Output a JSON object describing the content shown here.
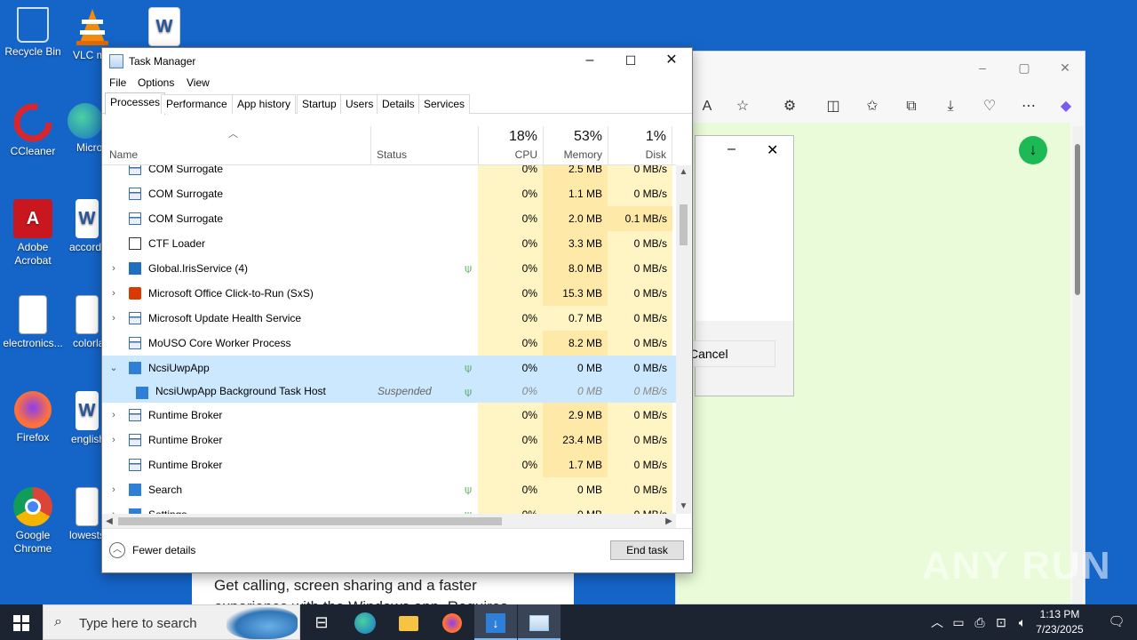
{
  "desktop": {
    "icons": [
      {
        "label": "Recycle Bin",
        "icon": "recycle-bin-icon"
      },
      {
        "label": "VLC media player",
        "icon": "vlc-icon"
      },
      {
        "label": "",
        "icon": "word-doc-icon"
      },
      {
        "label": "CCleaner",
        "icon": "ccleaner-icon"
      },
      {
        "label": "Microsoft Edge",
        "icon": "edge-icon"
      },
      {
        "label": "Adobe Acrobat",
        "icon": "acrobat-icon"
      },
      {
        "label": "accord...",
        "icon": "word-doc-icon"
      },
      {
        "label": "electronics...",
        "icon": "image-file-icon"
      },
      {
        "label": "colorla...",
        "icon": "image-file-icon"
      },
      {
        "label": "Firefox",
        "icon": "firefox-icon"
      },
      {
        "label": "english...",
        "icon": "word-doc-icon"
      },
      {
        "label": "Google Chrome",
        "icon": "chrome-icon"
      },
      {
        "label": "lowests...",
        "icon": "image-file-icon"
      }
    ]
  },
  "edge": {
    "dialog_cancel": "Cancel",
    "page_text_line1": "Get calling, screen sharing and a faster",
    "page_text_line2": "experience with the Windows app. Requires",
    "accent": "#e9fbd8"
  },
  "task_manager": {
    "title": "Task Manager",
    "menu": [
      "File",
      "Options",
      "View"
    ],
    "tabs": [
      "Processes",
      "Performance",
      "App history",
      "Startup",
      "Users",
      "Details",
      "Services"
    ],
    "active_tab": "Processes",
    "columns": {
      "name": "Name",
      "status": "Status",
      "cpu": {
        "pct": "18%",
        "label": "CPU"
      },
      "memory": {
        "pct": "53%",
        "label": "Memory"
      },
      "disk": {
        "pct": "1%",
        "label": "Disk"
      }
    },
    "rows": [
      {
        "name": "COM Surrogate",
        "expander": "",
        "icon": "window-icon",
        "status": "",
        "leaf": false,
        "cpu": "0%",
        "mem": "2.5 MB",
        "disk": "0 MB/s"
      },
      {
        "name": "COM Surrogate",
        "expander": "",
        "icon": "window-icon",
        "status": "",
        "leaf": false,
        "cpu": "0%",
        "mem": "1.1 MB",
        "disk": "0 MB/s"
      },
      {
        "name": "COM Surrogate",
        "expander": "",
        "icon": "window-icon",
        "status": "",
        "leaf": false,
        "cpu": "0%",
        "mem": "2.0 MB",
        "disk": "0.1 MB/s"
      },
      {
        "name": "CTF Loader",
        "expander": "",
        "icon": "pen-icon",
        "status": "",
        "leaf": false,
        "cpu": "0%",
        "mem": "3.3 MB",
        "disk": "0 MB/s"
      },
      {
        "name": "Global.IrisService (4)",
        "expander": "›",
        "icon": "blue-x-icon",
        "status": "",
        "leaf": true,
        "cpu": "0%",
        "mem": "8.0 MB",
        "disk": "0 MB/s"
      },
      {
        "name": "Microsoft Office Click-to-Run (SxS)",
        "expander": "›",
        "icon": "office-icon",
        "status": "",
        "leaf": false,
        "cpu": "0%",
        "mem": "15.3 MB",
        "disk": "0 MB/s"
      },
      {
        "name": "Microsoft Update Health Service",
        "expander": "›",
        "icon": "window-icon",
        "status": "",
        "leaf": false,
        "cpu": "0%",
        "mem": "0.7 MB",
        "disk": "0 MB/s"
      },
      {
        "name": "MoUSO Core Worker Process",
        "expander": "",
        "icon": "window-icon",
        "status": "",
        "leaf": false,
        "cpu": "0%",
        "mem": "8.2 MB",
        "disk": "0 MB/s"
      },
      {
        "name": "NcsiUwpApp",
        "expander": "⌄",
        "icon": "blue-square-icon",
        "status": "",
        "leaf": true,
        "cpu": "0%",
        "mem": "0 MB",
        "disk": "0 MB/s",
        "selected": true
      },
      {
        "name": "NcsiUwpApp Background Task Host",
        "expander": "",
        "icon": "blue-square-icon",
        "status": "Suspended",
        "leaf": true,
        "cpu": "0%",
        "mem": "0 MB",
        "disk": "0 MB/s",
        "selected": true,
        "child": true
      },
      {
        "name": "Runtime Broker",
        "expander": "›",
        "icon": "window-icon",
        "status": "",
        "leaf": false,
        "cpu": "0%",
        "mem": "2.9 MB",
        "disk": "0 MB/s"
      },
      {
        "name": "Runtime Broker",
        "expander": "›",
        "icon": "window-icon",
        "status": "",
        "leaf": false,
        "cpu": "0%",
        "mem": "23.4 MB",
        "disk": "0 MB/s"
      },
      {
        "name": "Runtime Broker",
        "expander": "",
        "icon": "window-icon",
        "status": "",
        "leaf": false,
        "cpu": "0%",
        "mem": "1.7 MB",
        "disk": "0 MB/s"
      },
      {
        "name": "Search",
        "expander": "›",
        "icon": "search-icon",
        "status": "",
        "leaf": true,
        "cpu": "0%",
        "mem": "0 MB",
        "disk": "0 MB/s"
      },
      {
        "name": "Settings",
        "expander": "›",
        "icon": "gear-icon",
        "status": "",
        "leaf": true,
        "cpu": "0%",
        "mem": "0 MB",
        "disk": "0 MB/s"
      }
    ],
    "fewer_details": "Fewer details",
    "end_task": "End task"
  },
  "taskbar": {
    "search_placeholder": "Type here to search",
    "time": "1:13 PM",
    "date": "7/23/2025"
  },
  "watermark": "ANY RUN"
}
